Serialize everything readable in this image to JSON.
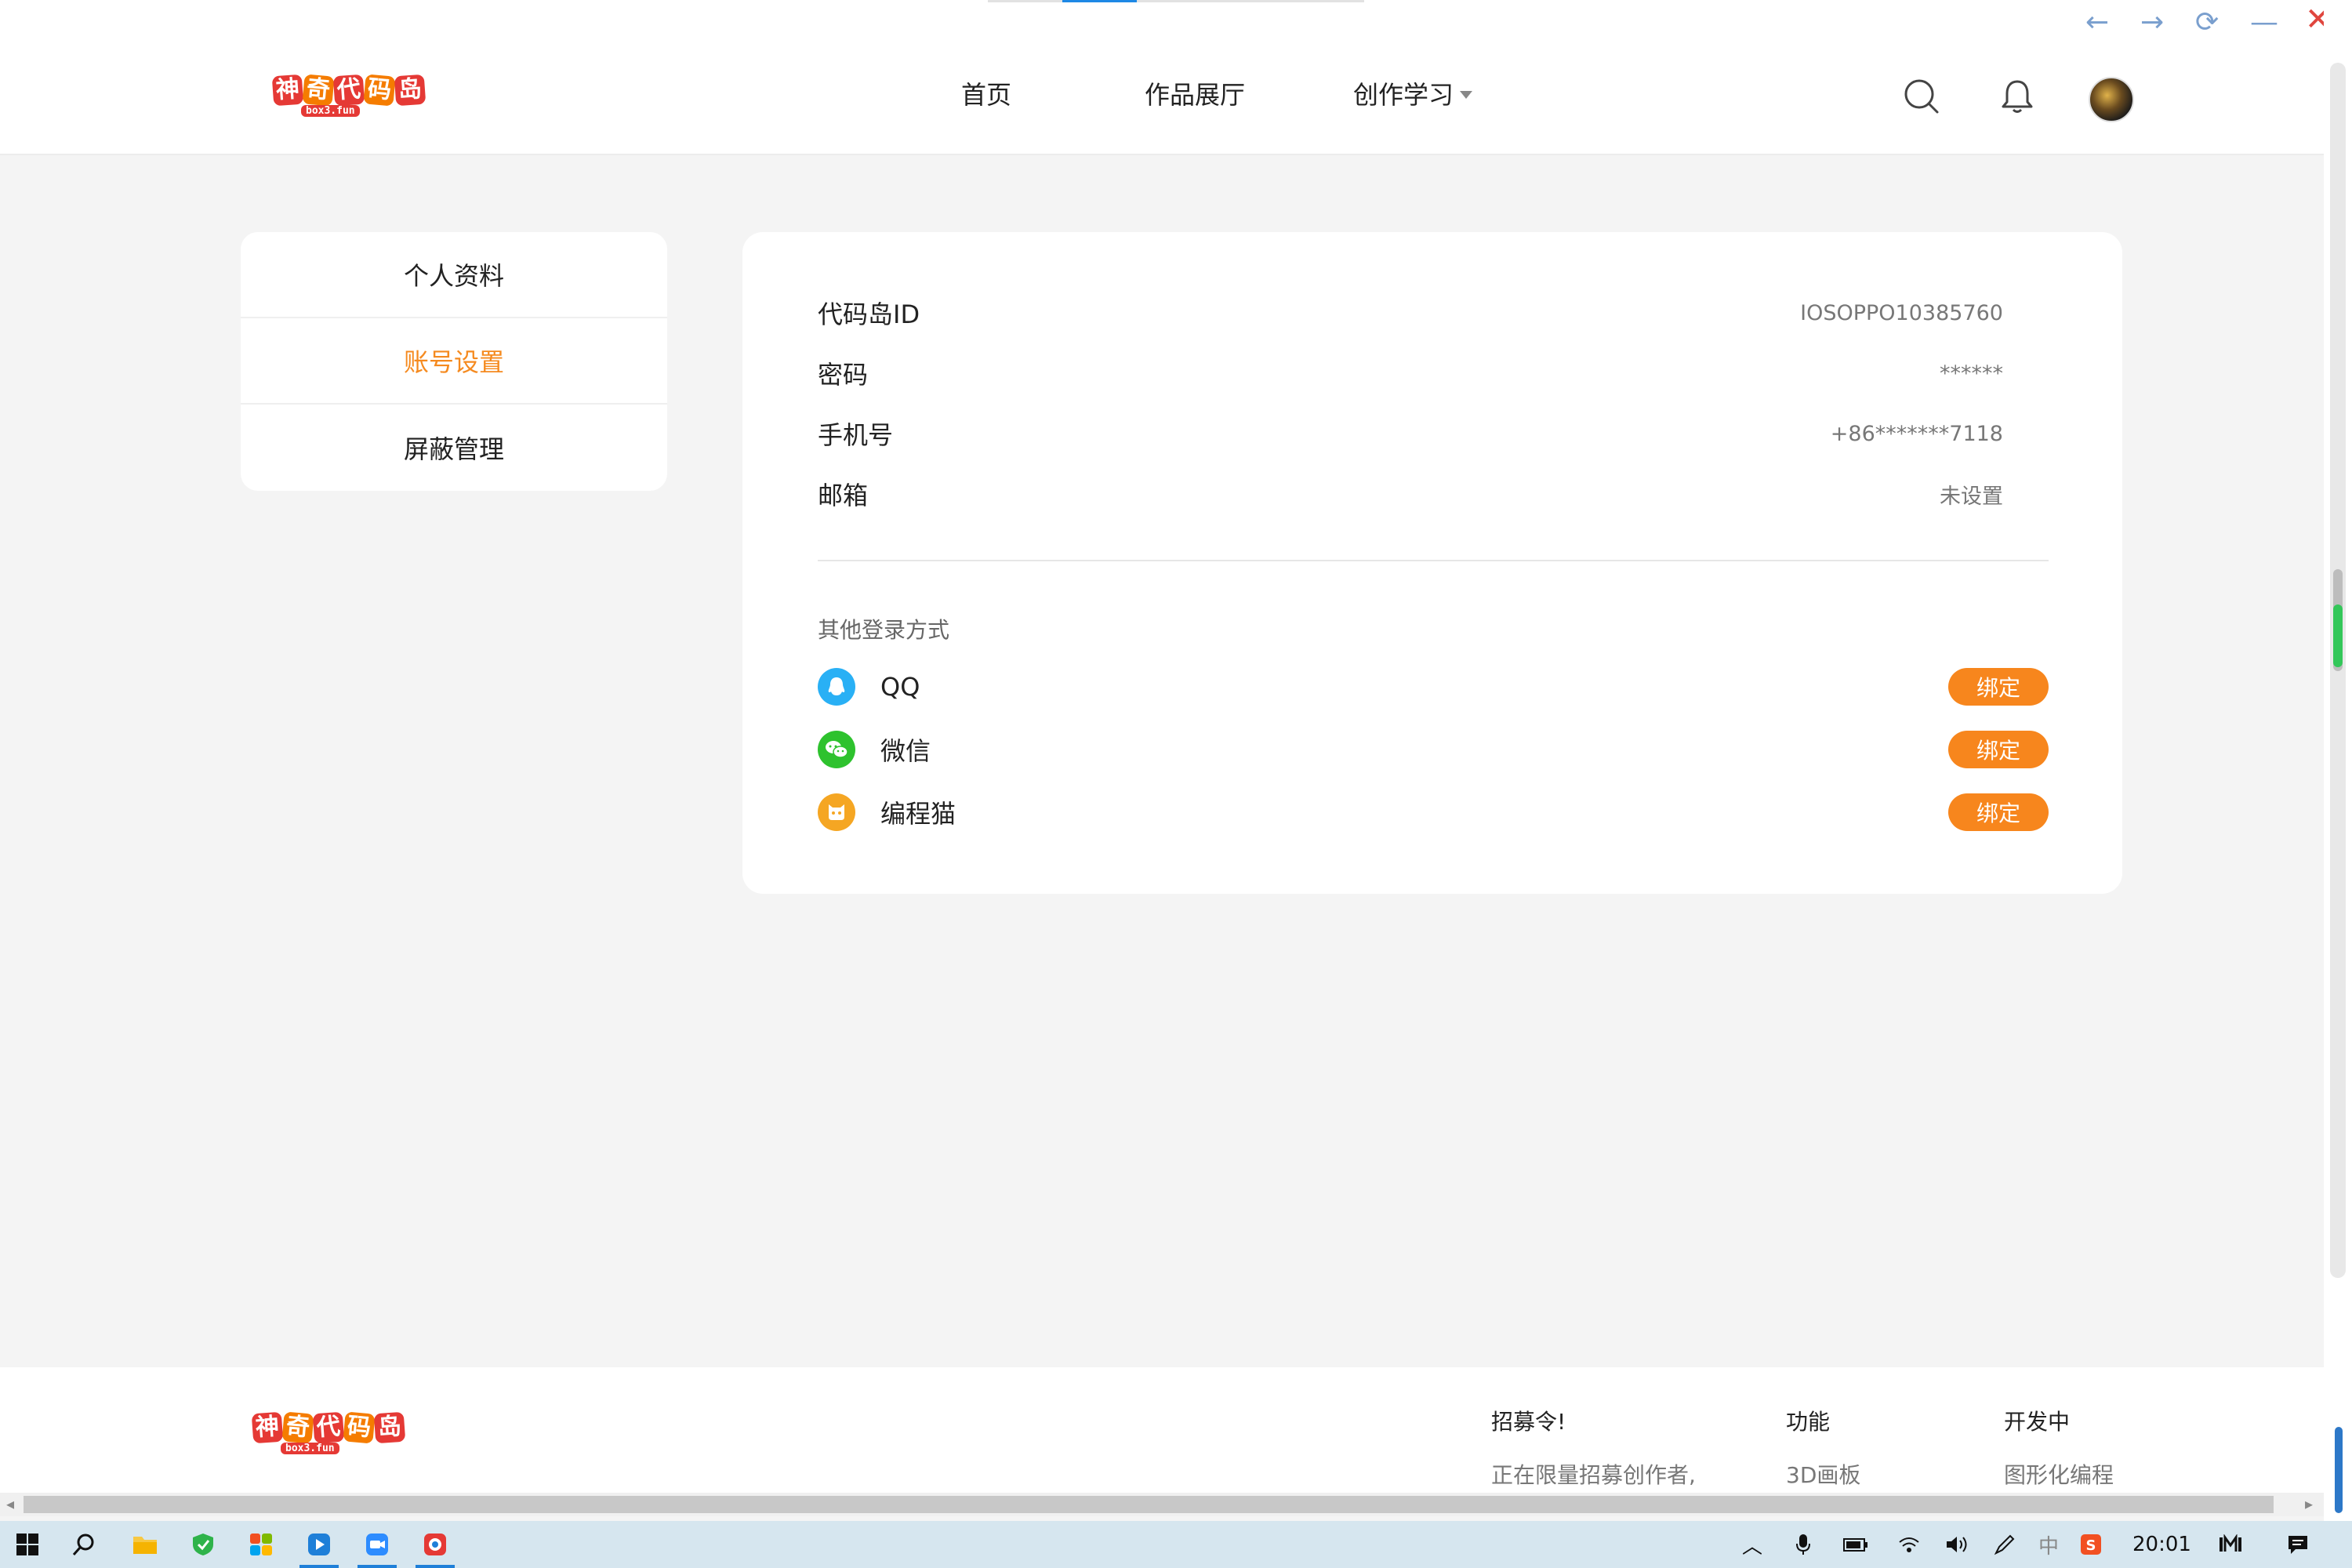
{
  "window": {
    "back_icon": "←",
    "forward_icon": "→",
    "reload_icon": "⟳",
    "minimize_icon": "—",
    "close_icon": "✕"
  },
  "header": {
    "logo_text": [
      "神",
      "奇",
      "代",
      "码",
      "岛"
    ],
    "logo_sub": "box3.fun",
    "nav": {
      "home": "首页",
      "gallery": "作品展厅",
      "learn": "创作学习"
    }
  },
  "sidebar": {
    "items": [
      {
        "label": "个人资料",
        "active": false
      },
      {
        "label": "账号设置",
        "active": true
      },
      {
        "label": "屏蔽管理",
        "active": false
      }
    ]
  },
  "account": {
    "rows": [
      {
        "key": "代码岛ID",
        "value": "IOSOPPO10385760"
      },
      {
        "key": "密码",
        "value": "******"
      },
      {
        "key": "手机号",
        "value": "+86*******7118"
      },
      {
        "key": "邮箱",
        "value": "未设置"
      }
    ],
    "other_login_title": "其他登录方式",
    "providers": [
      {
        "name": "QQ",
        "icon": "qq-icon",
        "color": "#29b0f5",
        "button": "绑定"
      },
      {
        "name": "微信",
        "icon": "wechat-icon",
        "color": "#2ec22e",
        "button": "绑定"
      },
      {
        "name": "编程猫",
        "icon": "codemao-icon",
        "color": "#f5a623",
        "button": "绑定"
      }
    ]
  },
  "footer": {
    "logo_text": [
      "神",
      "奇",
      "代",
      "码",
      "岛"
    ],
    "logo_sub": "box3.fun",
    "columns": [
      {
        "heading": "招募令!",
        "text": "正在限量招募创作者,"
      },
      {
        "heading": "功能",
        "text": "3D画板"
      },
      {
        "heading": "开发中",
        "text": "图形化编程"
      }
    ]
  },
  "taskbar": {
    "time": "20:01",
    "ime": "中"
  },
  "colors": {
    "accent": "#f7861d",
    "active_menu": "#f58a1f"
  }
}
